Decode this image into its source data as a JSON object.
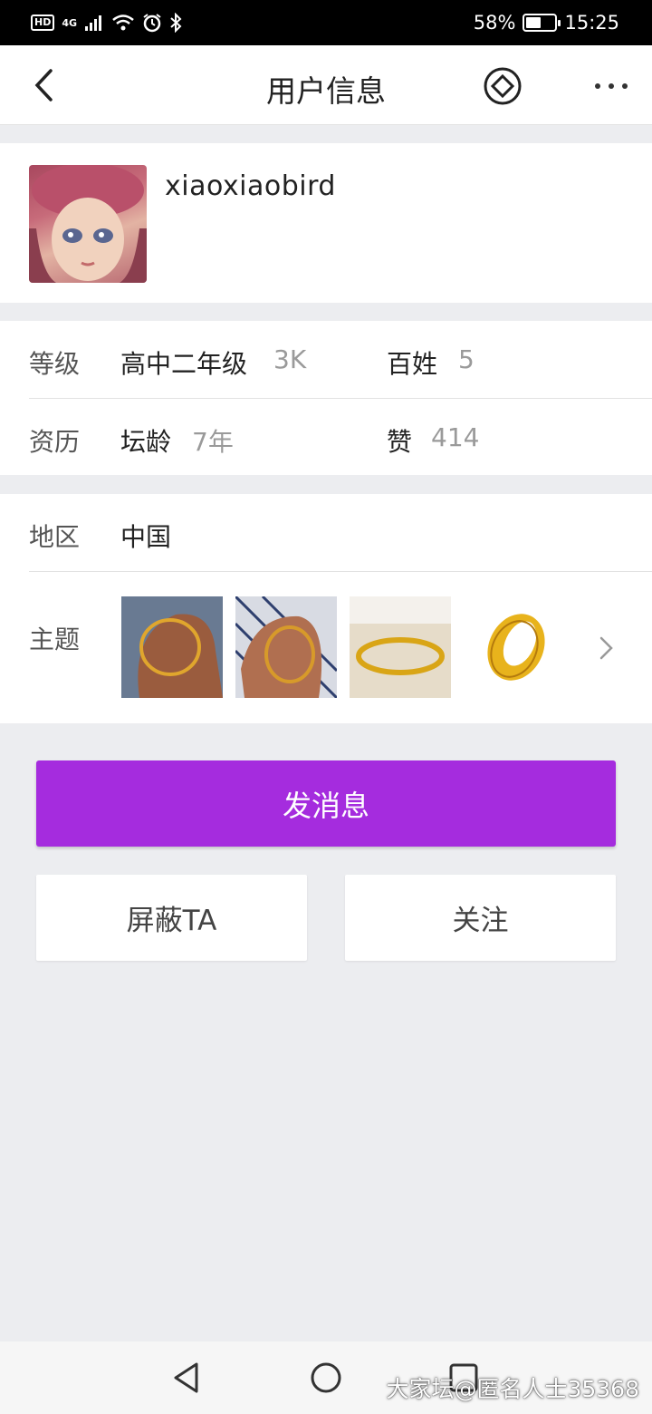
{
  "status_bar": {
    "left_badges": [
      "HD",
      "4G"
    ],
    "battery": "58%",
    "battery_level": 0.58,
    "time": "15:25"
  },
  "header": {
    "title": "用户信息"
  },
  "profile": {
    "username": "xiaoxiaobird"
  },
  "stats": {
    "row1": {
      "key": "等级",
      "level": "高中二年级",
      "level_score": "3K",
      "other_key": "百姓",
      "other_val": "5"
    },
    "row2": {
      "key": "资历",
      "age_key": "坛龄",
      "age_val": "7年",
      "likes_key": "赞",
      "likes_val": "414"
    }
  },
  "misc": {
    "region_key": "地区",
    "region_val": "中国",
    "topics_key": "主题"
  },
  "actions": {
    "message": "发消息",
    "block": "屏蔽TA",
    "follow": "关注"
  },
  "colors": {
    "accent": "#A52CDE",
    "background": "#ECEDF0"
  },
  "watermark": "大家坛@匿名人士35368"
}
